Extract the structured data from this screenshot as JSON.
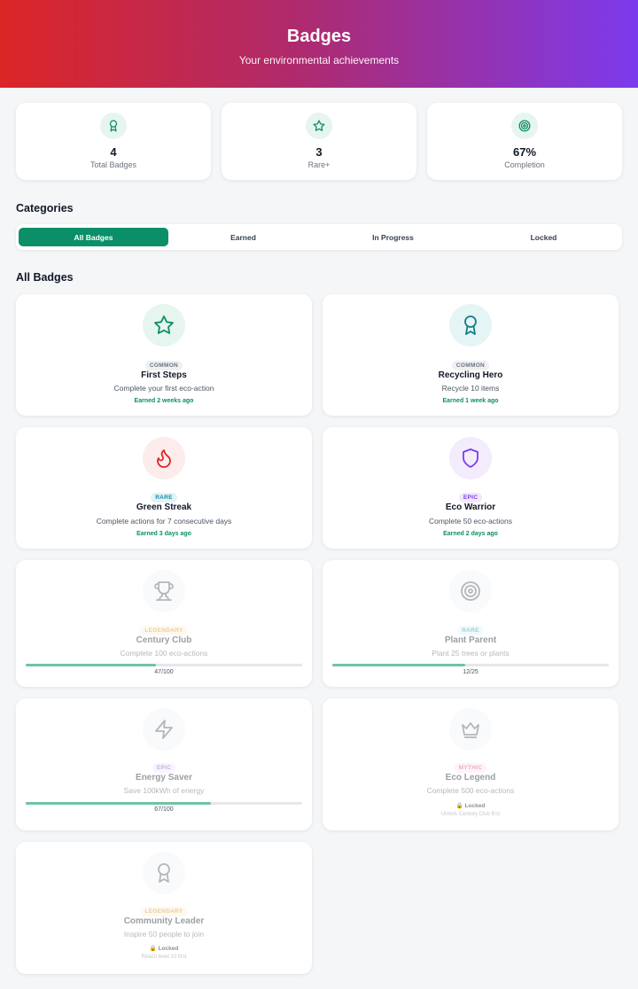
{
  "header": {
    "title": "Badges",
    "subtitle": "Your environmental achievements"
  },
  "stats": [
    {
      "icon": "award-icon",
      "value": "4",
      "label": "Total Badges"
    },
    {
      "icon": "star-icon",
      "value": "3",
      "label": "Rare+"
    },
    {
      "icon": "target-icon",
      "value": "67%",
      "label": "Completion"
    }
  ],
  "categories": {
    "title": "Categories",
    "tabs": [
      "All Badges",
      "Earned",
      "In Progress",
      "Locked"
    ],
    "active": "All Badges"
  },
  "badges_section": {
    "title": "All Badges"
  },
  "badges": [
    {
      "icon": "star-icon",
      "rarity": "COMMON",
      "name": "First Steps",
      "description": "Complete your first eco-action",
      "earned": "Earned 2 weeks ago"
    },
    {
      "icon": "award-icon",
      "rarity": "COMMON",
      "name": "Recycling Hero",
      "description": "Recycle 10 items",
      "earned": "Earned 1 week ago"
    },
    {
      "icon": "flame-icon",
      "rarity": "RARE",
      "name": "Green Streak",
      "description": "Complete actions for 7 consecutive days",
      "earned": "Earned 3 days ago"
    },
    {
      "icon": "shield-icon",
      "rarity": "EPIC",
      "name": "Eco Warrior",
      "description": "Complete 50 eco-actions",
      "earned": "Earned 2 days ago"
    },
    {
      "icon": "trophy-icon",
      "rarity": "LEGENDARY",
      "name": "Century Club",
      "description": "Complete 100 eco-actions",
      "progress_text": "47/100",
      "progress": 0.47
    },
    {
      "icon": "target-icon",
      "rarity": "RARE",
      "name": "Plant Parent",
      "description": "Plant 25 trees or plants",
      "progress_text": "12/25",
      "progress": 0.48
    },
    {
      "icon": "zap-icon",
      "rarity": "EPIC",
      "name": "Energy Saver",
      "description": "Save 100kWh of energy",
      "progress_text": "67/100",
      "progress": 0.67
    },
    {
      "icon": "crown-icon",
      "rarity": "MYTHIC",
      "name": "Eco Legend",
      "description": "Complete 500 eco-actions",
      "locked": "🔒 Locked",
      "lock_hint": "Unlock Century Club first"
    },
    {
      "icon": "award-icon",
      "rarity": "LEGENDARY",
      "name": "Community Leader",
      "description": "Inspire 50 people to join",
      "locked": "🔒 Locked",
      "lock_hint": "Reach level 10 first"
    }
  ],
  "colors": {
    "primary": "#0b8f68",
    "header_gradient": [
      "#dc2626",
      "#7c3aed"
    ],
    "icon_green": "#0b8f68",
    "icon_teal": "#0f7f86",
    "icon_red": "#dc2626",
    "icon_purple": "#7c3aed"
  }
}
